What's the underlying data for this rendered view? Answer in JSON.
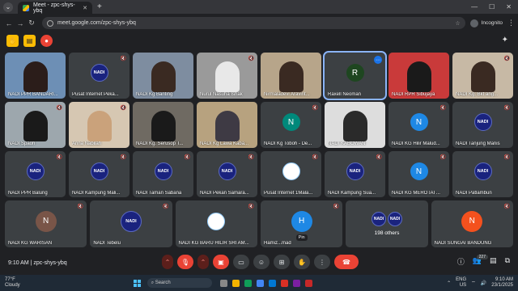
{
  "browser": {
    "tab_title": "Meet - zpc-shys-ybq",
    "url": "meet.google.com/zpc-shys-ybq",
    "profile_label": "Incognito"
  },
  "tiles": [
    [
      {
        "name": "NADI PPR BANDARI...",
        "kind": "video",
        "color": "#6d8fb5",
        "person": "#2b1d1a"
      },
      {
        "name": "Pusat Internet Peka...",
        "kind": "nadi",
        "mute": true
      },
      {
        "name": "NADI Kg Banting",
        "kind": "video",
        "color": "#7e8da0",
        "person": "#3a2a22"
      },
      {
        "name": "Nurul Nasuha Ishak",
        "kind": "video",
        "color": "#9a9a9a",
        "person": "#e8e8e8",
        "mute": true
      },
      {
        "name": "Nirmaladevi Aravint...",
        "kind": "video",
        "color": "#b7a58a",
        "person": "#3a2a22"
      },
      {
        "name": "Raxell Neoman",
        "kind": "avatar",
        "letter": "R",
        "avatar_color": "#1e4620",
        "selected": true,
        "more": true
      },
      {
        "name": "NADI RPR Sibujaya",
        "kind": "video",
        "color": "#c93a3a",
        "person": "#1a1a1a"
      },
      {
        "name": "NADI Kg. Bkt ang...",
        "kind": "video",
        "color": "#c7b9a5",
        "person": "#3a2a22",
        "mute": true
      }
    ],
    [
      {
        "name": "NADI Spaoh",
        "kind": "video",
        "color": "#9da7ad",
        "person": "#1a1a1a",
        "mute": true
      },
      {
        "name": "Arina Nabilah",
        "kind": "video",
        "color": "#d6c7b2",
        "person": "#caa27b",
        "mute": true
      },
      {
        "name": "NADI Kg. Serusop T...",
        "kind": "video",
        "color": "#6f6a62",
        "person": "#1a1a1a"
      },
      {
        "name": "NADI Kg Lawa Kaba...",
        "kind": "video",
        "color": "#b7a27f",
        "person": "#3e3a44"
      },
      {
        "name": "NADI Kg Toboh - De...",
        "kind": "avatar",
        "letter": "N",
        "avatar_color": "#00897b",
        "mute": true
      },
      {
        "name": "NADI KABOWAN",
        "kind": "video",
        "color": "#ddd",
        "person": "#2a2a2a"
      },
      {
        "name": "NADI KG Hilir Malud...",
        "kind": "avatar",
        "letter": "N",
        "avatar_color": "#1e88e5",
        "mute": true
      },
      {
        "name": "NADI Tanjung Manis",
        "kind": "nadi",
        "mute": true
      }
    ],
    [
      {
        "name": "NADI PPR Balung",
        "kind": "nadi",
        "mute": true
      },
      {
        "name": "NADI Kampung Mali...",
        "kind": "nadi",
        "mute": true
      },
      {
        "name": "NADI Taman Sabana",
        "kind": "nadi",
        "mute": true
      },
      {
        "name": "NADI Pekan Samara...",
        "kind": "nadi",
        "mute": true
      },
      {
        "name": "Pusat Internet 1Mala...",
        "kind": "logo",
        "mute": true
      },
      {
        "name": "NADI Kampung Sua...",
        "kind": "nadi",
        "mute": true
      },
      {
        "name": "NADI KG MEROTAI ...",
        "kind": "avatar",
        "letter": "N",
        "avatar_color": "#1e88e5",
        "mute": true
      },
      {
        "name": "NADI Patlambun",
        "kind": "nadi",
        "mute": true
      }
    ]
  ],
  "last_row": [
    {
      "name": "NADI KG WARISAN",
      "kind": "avatar",
      "letter": "N",
      "avatar_color": "#795548",
      "mute": true
    },
    {
      "name": "NADI Tebelu",
      "kind": "nadi",
      "mute": true
    },
    {
      "name": "NADI KG BARU HILIR SRI AM...",
      "kind": "logo",
      "mute": true
    },
    {
      "name": "Hamiz...mad",
      "kind": "avatar",
      "letter": "H",
      "avatar_color": "#1e88e5",
      "mute": true,
      "pin": "Pin"
    },
    {
      "name": "198 others",
      "kind": "others"
    },
    {
      "name": "NADI SUNGAI BANDUNG",
      "kind": "avatar",
      "letter": "N",
      "avatar_color": "#f4511e",
      "mute": true
    }
  ],
  "meeting": {
    "time": "9:10 AM",
    "code": "zpc-shys-ybq",
    "participants_badge": "227"
  },
  "taskbar": {
    "temp": "77°F",
    "weather": "Cloudy",
    "search_placeholder": "Search",
    "time": "9:10 AM",
    "date": "23/1/2025",
    "lang": "ENG",
    "region": "US"
  }
}
